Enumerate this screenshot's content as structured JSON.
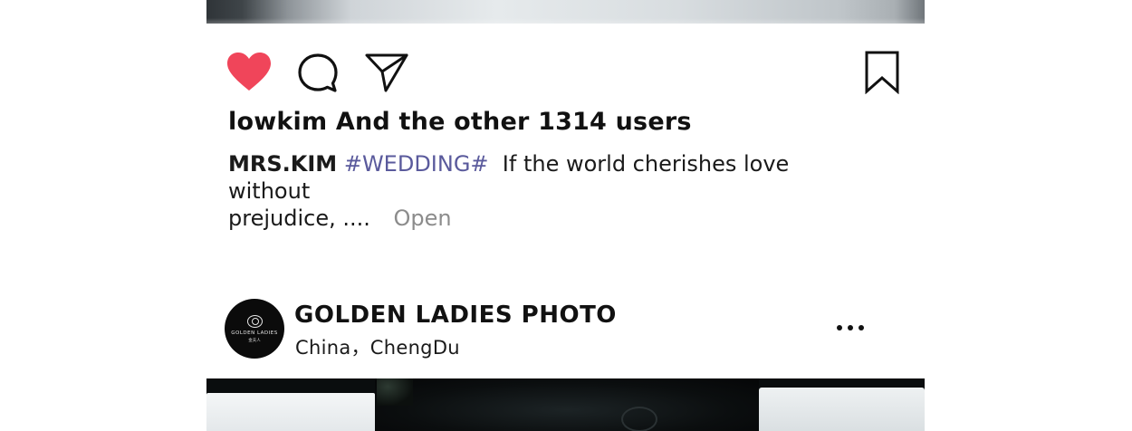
{
  "post1": {
    "likes_text": "lowkim And the other 1314 users",
    "caption": {
      "username": "MRS.KIM",
      "hashtag": "#WEDDING#",
      "text_line1": "If the world cherishes love without",
      "text_line2": "prejudice, ....",
      "open_label": "Open"
    },
    "actions": {
      "like_icon": "heart-icon",
      "comment_icon": "comment-icon",
      "share_icon": "send-icon",
      "bookmark_icon": "bookmark-icon",
      "like_color": "#f0455a",
      "liked": true
    }
  },
  "post2": {
    "account_name": "GOLDEN LADIES PHOTO",
    "location": "China，ChengDu",
    "avatar_logo_text": "GOLDEN LADIES",
    "avatar_logo_sub": "金夫人",
    "more_icon": "more-dots-icon"
  },
  "colors": {
    "hashtag": "#5a5a9c",
    "open_link": "#8c8c8c",
    "text": "#111111"
  }
}
